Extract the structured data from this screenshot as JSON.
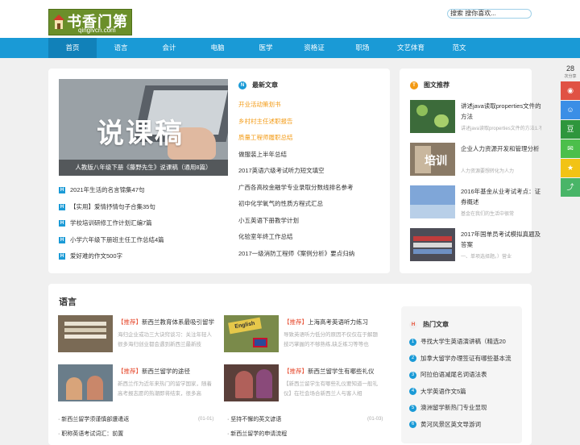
{
  "logo": {
    "title": "书香门第",
    "domain": "qinglvcn.com"
  },
  "search": {
    "placeholder": "搜索 搜你喜欢..."
  },
  "nav": [
    "首页",
    "语言",
    "会计",
    "电脑",
    "医学",
    "资格证",
    "职场",
    "文艺体育",
    "范文"
  ],
  "hero": {
    "big": "说课稿",
    "caption": "人教版八年级下册《藤野先生》说课稿（通用8篇）"
  },
  "left_list": [
    "2021年生活的名言锦集47句",
    "【实用】爱情抒情句子合集35句",
    "学校培训研修工作计划汇编7篇",
    "小学六年级下册班主任工作总结4篇",
    "爱好难的作文500字"
  ],
  "latest": {
    "heading": "最新文章",
    "badge": "N",
    "items": [
      "开业活动策划书",
      "乡村村主任述职报告",
      "质量工程师履职总结",
      "做服装上半年总结",
      "2017英语六级考试听力短文填空",
      "广西各高校金融学专业录取分数线排名参考",
      "初中化学氧气的性质方程式汇总",
      "小五英语下册教学计划",
      "化验室年终工作总结",
      "2017一级消防工程师《案例分析》要点归纳"
    ]
  },
  "pics": {
    "heading": "图文推荐",
    "badge": "T",
    "items": [
      {
        "title": "讲述java读取properties文件的方法",
        "sub": "讲述java读取properties文件的方法1.不在项目"
      },
      {
        "title": "企业人力资源开发和管理分析",
        "sub": "人力资源要想转化为人力"
      },
      {
        "title": "2016年基金从业考试考点：证券概述",
        "sub": "基金在我们的生活中很常"
      },
      {
        "title": "2017年国单员考试模拟真题及答案",
        "sub": "一、单项选择题。）营业"
      }
    ]
  },
  "language": {
    "heading": "语言",
    "cards": [
      {
        "tag": "【推荐】",
        "title": "新西兰教育体系最吸引留学",
        "desc": "海归企业或功三大诀窍谈习：关注年轻人很多海归创业都会遇到新西兰最新技"
      },
      {
        "tag": "【推荐】",
        "title": "上海高考英语听力练习",
        "desc": "导致英语听力低分的原因不仅仅在于解题技巧掌握的不够熟练,缺乏练习等等也"
      },
      {
        "tag": "【推荐】",
        "title": "新西兰留学的途径",
        "desc": "新西兰作为近年来热门的留学国家，随着高考报志愿的热潮即将结束，很多高"
      },
      {
        "tag": "【推荐】",
        "title": "新西兰留学生有哪些礼仪",
        "desc": "【新西兰留学生有哪些礼仪要知道一般礼仪】在社会场合新西兰人与客人相"
      }
    ],
    "bottom": [
      {
        "title": "新西兰留学须谨慎部遭遣返",
        "date": "(01-01)"
      },
      {
        "title": "坚持不懈的英文谚语",
        "date": "(01-03)"
      },
      {
        "title": "职称英语考试词汇：前置",
        "date": ""
      },
      {
        "title": "新西兰留学的申请流程",
        "date": ""
      }
    ]
  },
  "hot": {
    "heading": "热门文章",
    "badge": "H",
    "items": [
      "寻找大学生英语演讲稿（精选20",
      "加拿大留学办理签证有哪些基本流",
      "阿拉伯语减尾名词语法表",
      "大学英语作文5篇",
      "澳洲留学新热门专业显现",
      "黄河风景区英文导游词"
    ]
  },
  "share": {
    "count": "28",
    "label": "次分享",
    "icons": [
      "weibo-icon",
      "qq-icon",
      "douban-icon",
      "wechat-icon",
      "qzone-icon",
      "share-icon"
    ]
  },
  "colors": {
    "accent": "#1a9ad6",
    "hot": "#f39a13",
    "tag": "#e64a2e"
  }
}
